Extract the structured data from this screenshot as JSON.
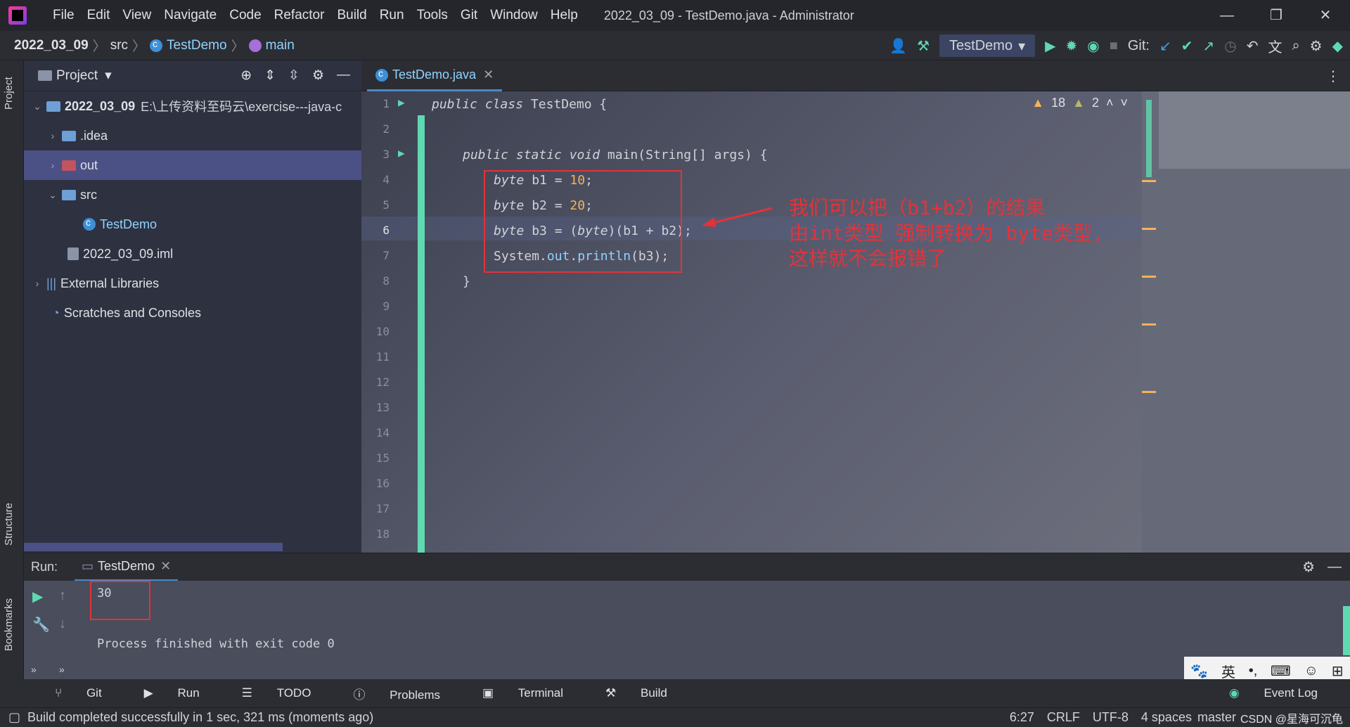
{
  "window": {
    "title": "2022_03_09 - TestDemo.java - Administrator",
    "menu": [
      "File",
      "Edit",
      "View",
      "Navigate",
      "Code",
      "Refactor",
      "Build",
      "Run",
      "Tools",
      "Git",
      "Window",
      "Help"
    ],
    "controls": {
      "minimize": "—",
      "restore": "❐",
      "close": "✕"
    }
  },
  "nav": {
    "project": "2022_03_09",
    "folder": "src",
    "class": "TestDemo",
    "method": "main",
    "run_config": "TestDemo",
    "git_label": "Git:"
  },
  "left_tools": {
    "project": "Project",
    "structure": "Structure",
    "bookmarks": "Bookmarks"
  },
  "project_panel": {
    "title": "Project",
    "root": "2022_03_09",
    "root_path": "E:\\上传资料至码云\\exercise---java-c",
    "items": [
      ".idea",
      "out",
      "src",
      "TestDemo",
      "2022_03_09.iml",
      "External Libraries",
      "Scratches and Consoles"
    ]
  },
  "editor": {
    "tab": "TestDemo.java",
    "warnings": "18",
    "weak_warnings": "2",
    "line_numbers": [
      "1",
      "2",
      "3",
      "4",
      "5",
      "6",
      "7",
      "8",
      "9",
      "10",
      "11",
      "12",
      "13",
      "14",
      "15",
      "16",
      "17",
      "18"
    ],
    "code": {
      "l1_kw": "public class",
      "l1_name": "TestDemo {",
      "l3_kw": "public static void",
      "l3_rest": "main(String[] args) {",
      "l4_kw": "byte",
      "l4_var": "b1 = ",
      "l4_num": "10",
      "l5_kw": "byte",
      "l5_var": "b2 = ",
      "l5_num": "20",
      "l6_kw": "byte",
      "l6_a": "b3 = (",
      "l6_kw2": "byte",
      "l6_b": ")(b1 + b2);",
      "l7_a": "System.",
      "l7_field": "out",
      "l7_b": ".",
      "l7_method": "println",
      "l7_c": "(b3);",
      "l8": "}",
      "semicolon": ";"
    },
    "annotation": [
      "我们可以把（b1+b2）的结果",
      "由int类型 强制转换为 byte类型,",
      "这样就不会报错了"
    ]
  },
  "run_panel": {
    "label": "Run:",
    "tab": "TestDemo",
    "output_value": "30",
    "output_finish": "Process finished with exit code 0"
  },
  "bottom_tools": [
    "Git",
    "Run",
    "TODO",
    "Problems",
    "Terminal",
    "Build"
  ],
  "event_log": "Event Log",
  "ime": {
    "lang": "英"
  },
  "status": {
    "message": "Build completed successfully in 1 sec, 321 ms (moments ago)",
    "position": "6:27",
    "line_sep": "CRLF",
    "encoding": "UTF-8",
    "indent": "4 spaces",
    "branch": "master",
    "watermark": "CSDN @星海可沉龟"
  }
}
